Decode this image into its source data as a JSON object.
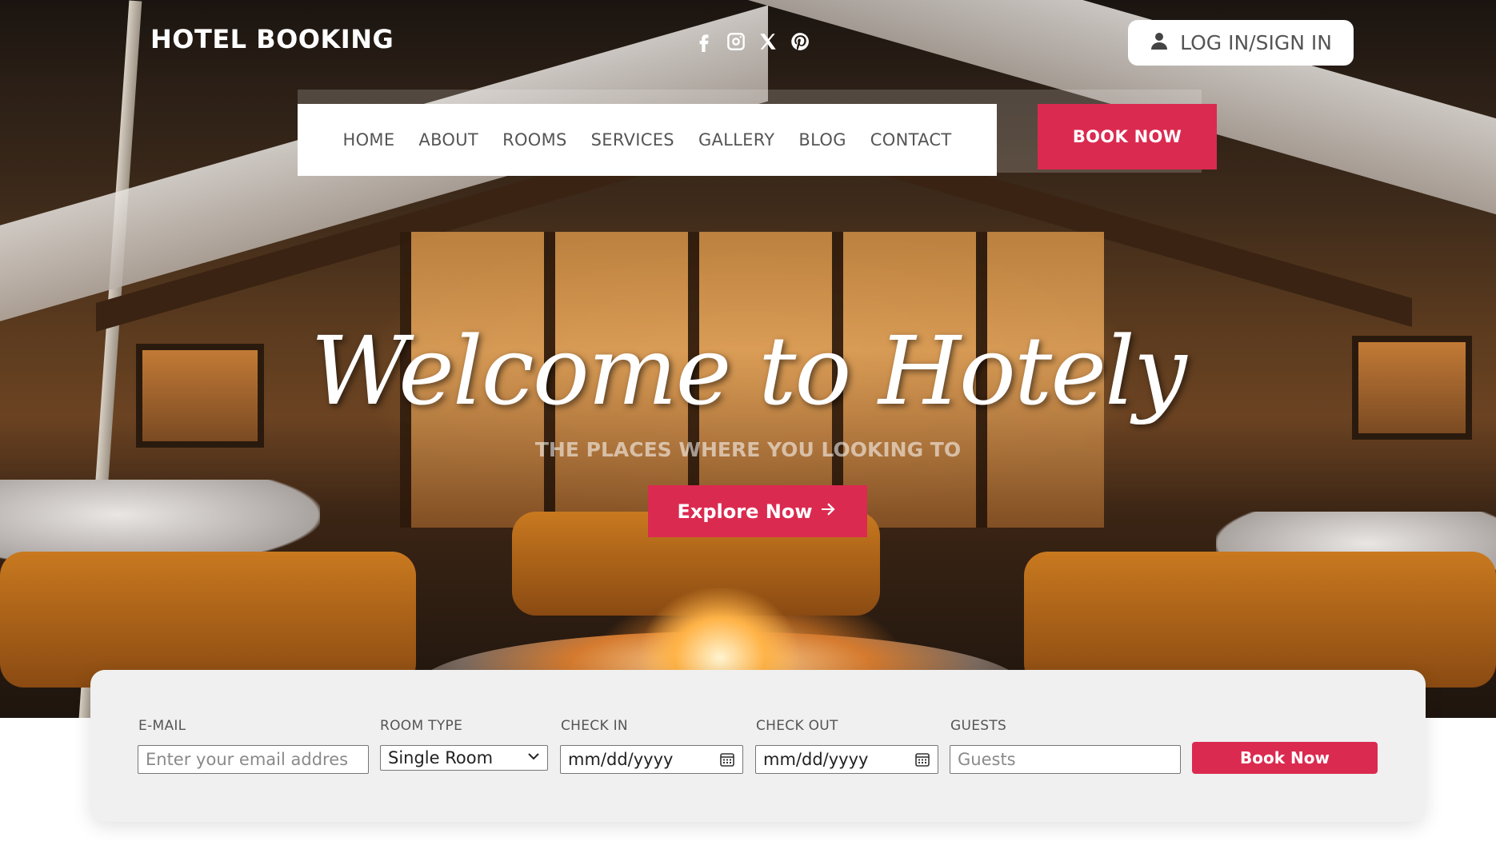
{
  "header": {
    "brand": "HOTEL BOOKING",
    "social_icons": [
      "facebook-icon",
      "instagram-icon",
      "x-icon",
      "pinterest-icon"
    ],
    "login_label": "LOG IN/SIGN IN"
  },
  "nav": {
    "items": [
      "HOME",
      "ABOUT",
      "ROOMS",
      "SERVICES",
      "GALLERY",
      "BLOG",
      "CONTACT"
    ],
    "book_now_label": "BOOK NOW"
  },
  "hero": {
    "title": "Welcome to Hotely",
    "subtitle": "THE PLACES WHERE YOU LOOKING TO",
    "cta_label": "Explore Now"
  },
  "booking": {
    "email_label": "E-MAIL",
    "email_placeholder": "Enter your email addres",
    "room_type_label": "ROOM TYPE",
    "room_type_value": "Single Room",
    "check_in_label": "CHECK IN",
    "check_in_placeholder": "mm/dd/yyyy",
    "check_out_label": "CHECK OUT",
    "check_out_placeholder": "mm/dd/yyyy",
    "guests_label": "GUESTS",
    "guests_placeholder": "Guests",
    "submit_label": "Book Now"
  },
  "colors": {
    "accent": "#db2a50",
    "panel_bg": "#f0f0f0",
    "nav_text": "#555555"
  }
}
